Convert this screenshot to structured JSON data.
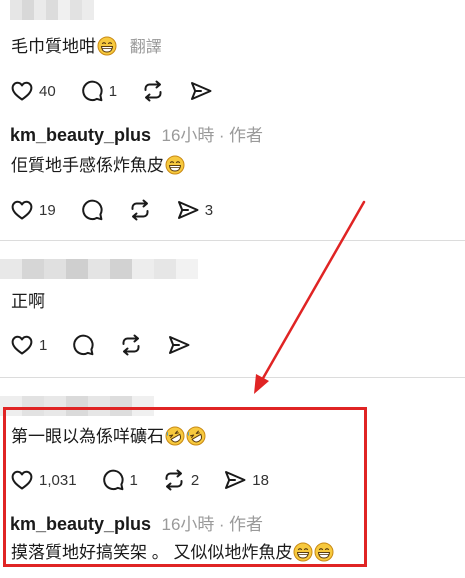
{
  "comment1": {
    "text": "毛巾質地咁",
    "translate_label": "翻譯",
    "likes": "40",
    "replies": "1"
  },
  "reply1": {
    "username": "km_beauty_plus",
    "time": "16小時",
    "separator": "·",
    "author_tag": "作者",
    "text": "佢質地手感係炸魚皮",
    "likes": "19",
    "shares": "3"
  },
  "comment2": {
    "text": "正啊",
    "likes": "1"
  },
  "comment3": {
    "text": "第一眼以為係咩礦石",
    "likes": "1,031",
    "replies": "1",
    "reposts": "2",
    "shares": "18"
  },
  "reply2": {
    "username": "km_beauty_plus",
    "time": "16小時",
    "separator": "·",
    "author_tag": "作者",
    "text": "摸落質地好搞笑架 。 又似似地炸魚皮"
  },
  "colors": {
    "highlight": "#e02424",
    "arrow": "#e02424",
    "meta_gray": "#9a9a9a"
  },
  "icons": [
    "heart-icon",
    "comment-icon",
    "repost-icon",
    "share-icon",
    "grin-sweat-emoji",
    "rofl-emoji"
  ]
}
